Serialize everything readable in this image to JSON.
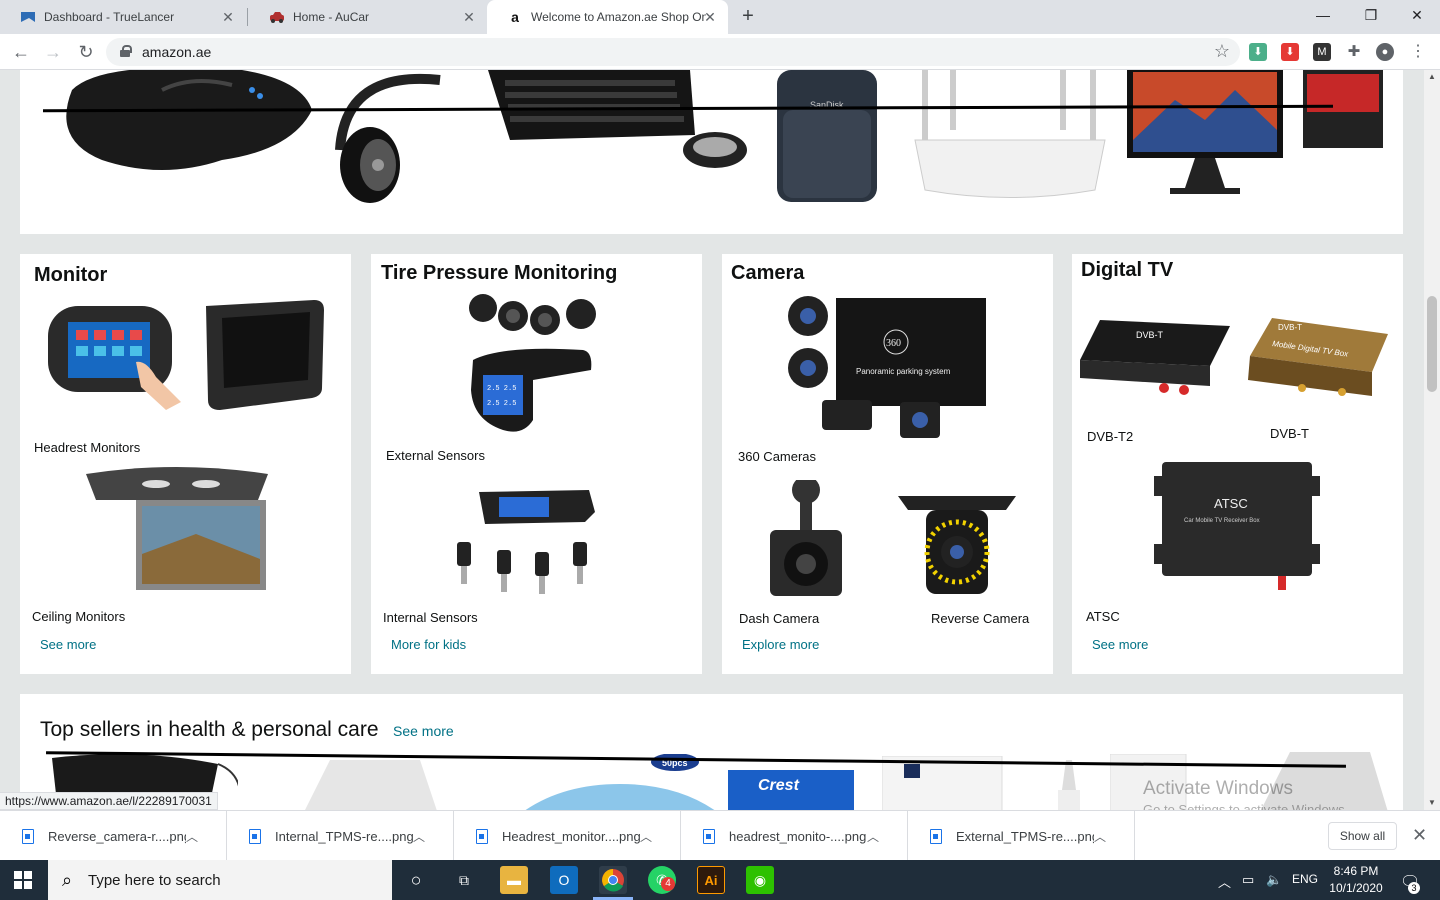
{
  "browser": {
    "tabs": [
      {
        "title": "Dashboard - TrueLancer",
        "icon": "truelancer-icon"
      },
      {
        "title": "Home - AuCar",
        "icon": "aucar-icon"
      },
      {
        "title": "Welcome to Amazon.ae Shop Onl",
        "icon": "amazon-icon"
      }
    ],
    "url": "amazon.ae",
    "status_url": "https://www.amazon.ae/l/22289170031"
  },
  "cards": {
    "monitor": {
      "title": "Monitor",
      "items": [
        "Headrest Monitors",
        "Ceiling Monitors"
      ],
      "link": "See more"
    },
    "tpms": {
      "title": "Tire Pressure Monitoring",
      "items": [
        "External Sensors",
        "Internal Sensors"
      ],
      "link": "More for kids"
    },
    "camera": {
      "title": "Camera",
      "items": [
        "360 Cameras",
        "Dash Camera",
        "Reverse Camera"
      ],
      "link": "Explore more",
      "img_text": "Panoramic parking system"
    },
    "digitaltv": {
      "title": "Digital TV",
      "items": [
        "DVB-T2",
        "DVB-T",
        "ATSC"
      ],
      "link": "See more",
      "img_text": [
        "DVB-T",
        "Mobile Digital TV Box",
        "ATSC",
        "Car Mobile TV Receiver Box"
      ]
    }
  },
  "top_sellers": {
    "title": "Top sellers in health & personal care",
    "link": "See more",
    "product_text": [
      "50pcs",
      "Crest"
    ]
  },
  "watermark": {
    "line1": "Activate Windows",
    "line2": "Go to Settings to activate Windows."
  },
  "downloads": {
    "files": [
      "Reverse_camera-r....png",
      "Internal_TPMS-re....png",
      "Headrest_monitor....png",
      "headrest_monito-....png",
      "External_TPMS-re....png"
    ],
    "show_all": "Show all"
  },
  "taskbar": {
    "search_placeholder": "Type here to search",
    "language": "ENG",
    "time": "8:46 PM",
    "date": "10/1/2020",
    "notification_count": "3",
    "whatsapp_badge": "4"
  }
}
